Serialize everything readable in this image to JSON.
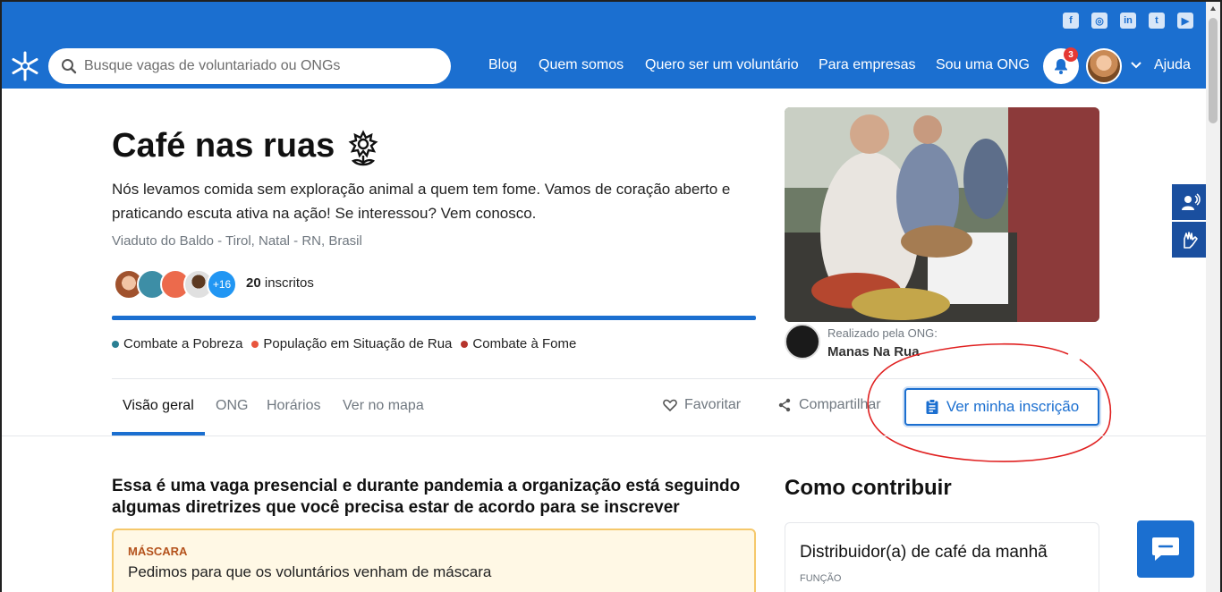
{
  "header": {
    "search_placeholder": "Busque vagas de voluntariado ou ONGs",
    "nav": [
      "Blog",
      "Quem somos",
      "Quero ser um voluntário",
      "Para empresas",
      "Sou uma ONG"
    ],
    "notifications_count": "3",
    "help_label": "Ajuda",
    "social_icons": [
      "facebook-icon",
      "instagram-icon",
      "linkedin-icon",
      "twitter-icon",
      "youtube-icon"
    ]
  },
  "project": {
    "title": "Café nas ruas",
    "description": "Nós levamos comida sem exploração animal a quem tem fome. Vamos de coração aberto e praticando escuta ativa na ação! Se interessou? Vem conosco.",
    "location": "Viaduto do Baldo - Tirol, Natal - RN, Brasil",
    "extra_volunteers": "+16",
    "subscribers_count": "20",
    "subscribers_label": "inscritos",
    "causes": [
      {
        "label": "Combate a Pobreza",
        "color": "#2a7f93"
      },
      {
        "label": "População em Situação de Rua",
        "color": "#e8553d"
      },
      {
        "label": "Combate à Fome",
        "color": "#b5342c"
      }
    ]
  },
  "ong": {
    "caption": "Realizado pela ONG:",
    "name": "Manas Na Rua"
  },
  "tabs": [
    "Visão geral",
    "ONG",
    "Horários",
    "Ver no mapa"
  ],
  "actions": {
    "favorite": "Favoritar",
    "share": "Compartilhar",
    "view_subscription": "Ver minha inscrição"
  },
  "guidelines": {
    "title": "Essa é uma vaga presencial e durante pandemia a organização está seguindo algumas diretrizes que você precisa estar de acordo para se inscrever",
    "mask_label": "MÁSCARA",
    "mask_text": "Pedimos para que os voluntários venham de máscara"
  },
  "contribute": {
    "title": "Como contribuir",
    "role_name": "Distribuidor(a) de café da manhã",
    "role_label": "FUNÇÃO"
  },
  "colors": {
    "brand": "#1b6fd0",
    "annotation": "#e02020"
  }
}
